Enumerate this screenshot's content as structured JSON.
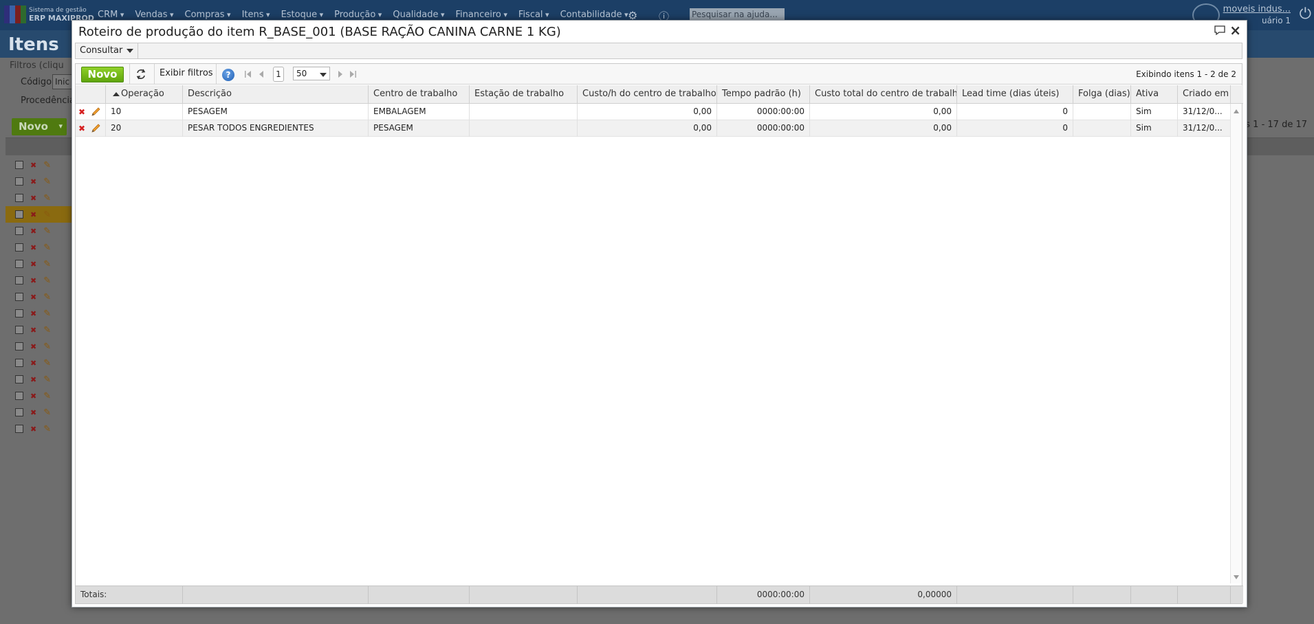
{
  "background": {
    "logo": {
      "sub": "Sistema de gestão",
      "main": "ERP MAXIPROD"
    },
    "nav": [
      "CRM",
      "Vendas",
      "Compras",
      "Itens",
      "Estoque",
      "Produção",
      "Qualidade",
      "Financeiro",
      "Fiscal",
      "Contabilidade"
    ],
    "search_placeholder": "Pesquisar na ajuda...",
    "user": {
      "company": "moveis indus...",
      "name": "uário 1"
    },
    "page_title": "Itens",
    "filters_legend": "Filtros (cliqu",
    "filter_codigo_label": "Código",
    "filter_codigo_value": "Inic",
    "filter_procedencia_label": "Procedência",
    "new_button": "Novo",
    "count": "s 1 - 17 de 17",
    "row_count": 17,
    "selected_row": 4
  },
  "modal": {
    "title": "Roteiro de produção do item R_BASE_001 (BASE RAÇÃO CANINA CARNE 1 KG)",
    "menu": {
      "consultar": "Consultar"
    },
    "toolbar": {
      "new_label": "Novo",
      "filters_label": "Exibir filtros",
      "help_label": "?",
      "page": "1",
      "page_size": "50",
      "info": "Exibindo itens 1 - 2 de 2"
    },
    "columns": [
      "Operação",
      "Descrição",
      "Centro de trabalho",
      "Estação de trabalho",
      "Custo/h do centro de trabalho",
      "Tempo padrão (h)",
      "Custo total do centro de trabalho",
      "Lead time (dias úteis)",
      "Folga (dias)",
      "Ativa",
      "Criado em"
    ],
    "rows": [
      [
        "10",
        "PESAGEM",
        "EMBALAGEM",
        "",
        "0,00",
        "0000:00:00",
        "0,00",
        "0",
        "",
        "Sim",
        "31/12/0..."
      ],
      [
        "20",
        "PESAR TODOS ENGREDIENTES",
        "PESAGEM",
        "",
        "0,00",
        "0000:00:00",
        "0,00",
        "0",
        "",
        "Sim",
        "31/12/0..."
      ]
    ],
    "totals": {
      "label": "Totais:",
      "tempo_padrao": "0000:00:00",
      "custo_total": "0,00000"
    }
  },
  "colors": {
    "accent_green": "#6bb515",
    "delete_red": "#d62020",
    "edit_orange": "#e08a1e",
    "topbar": "#1c3f66"
  }
}
